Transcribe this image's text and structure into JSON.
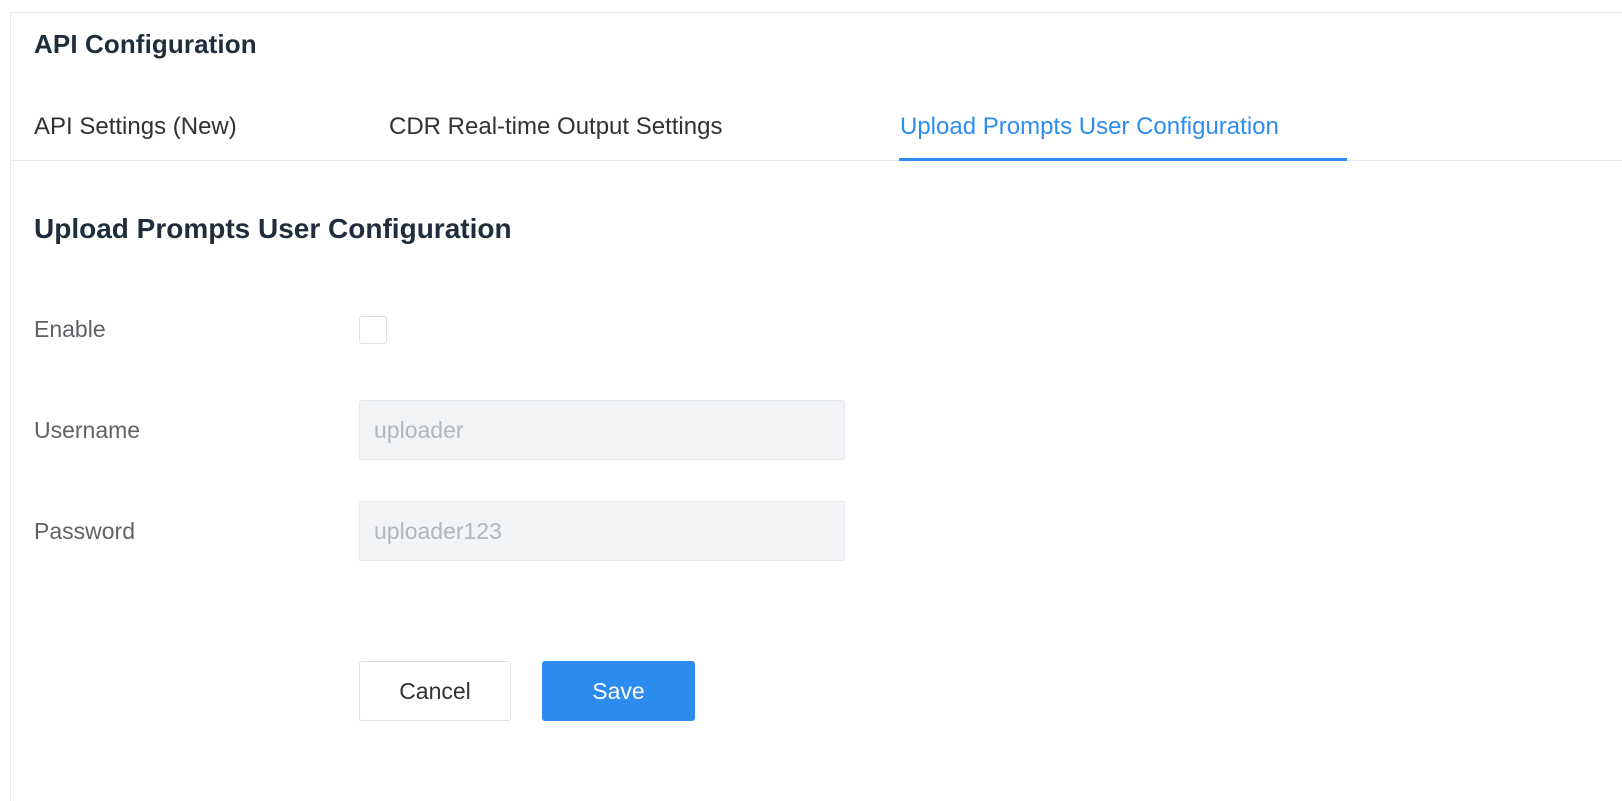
{
  "page": {
    "title": "API Configuration"
  },
  "tabs": [
    {
      "label": "API Settings (New)",
      "active": false
    },
    {
      "label": "CDR Real-time Output Settings",
      "active": false
    },
    {
      "label": "Upload Prompts User Configuration",
      "active": true
    }
  ],
  "section": {
    "title": "Upload Prompts User Configuration"
  },
  "form": {
    "enable": {
      "label": "Enable",
      "checked": false
    },
    "username": {
      "label": "Username",
      "value": "uploader",
      "disabled": true
    },
    "password": {
      "label": "Password",
      "value": "uploader123",
      "disabled": true
    }
  },
  "actions": {
    "cancel_label": "Cancel",
    "save_label": "Save"
  },
  "colors": {
    "accent": "#2d8cf0",
    "heading": "#1f2d3d",
    "label": "#606266",
    "disabled_bg": "#f3f4f6",
    "disabled_text": "#b2b6bd"
  }
}
